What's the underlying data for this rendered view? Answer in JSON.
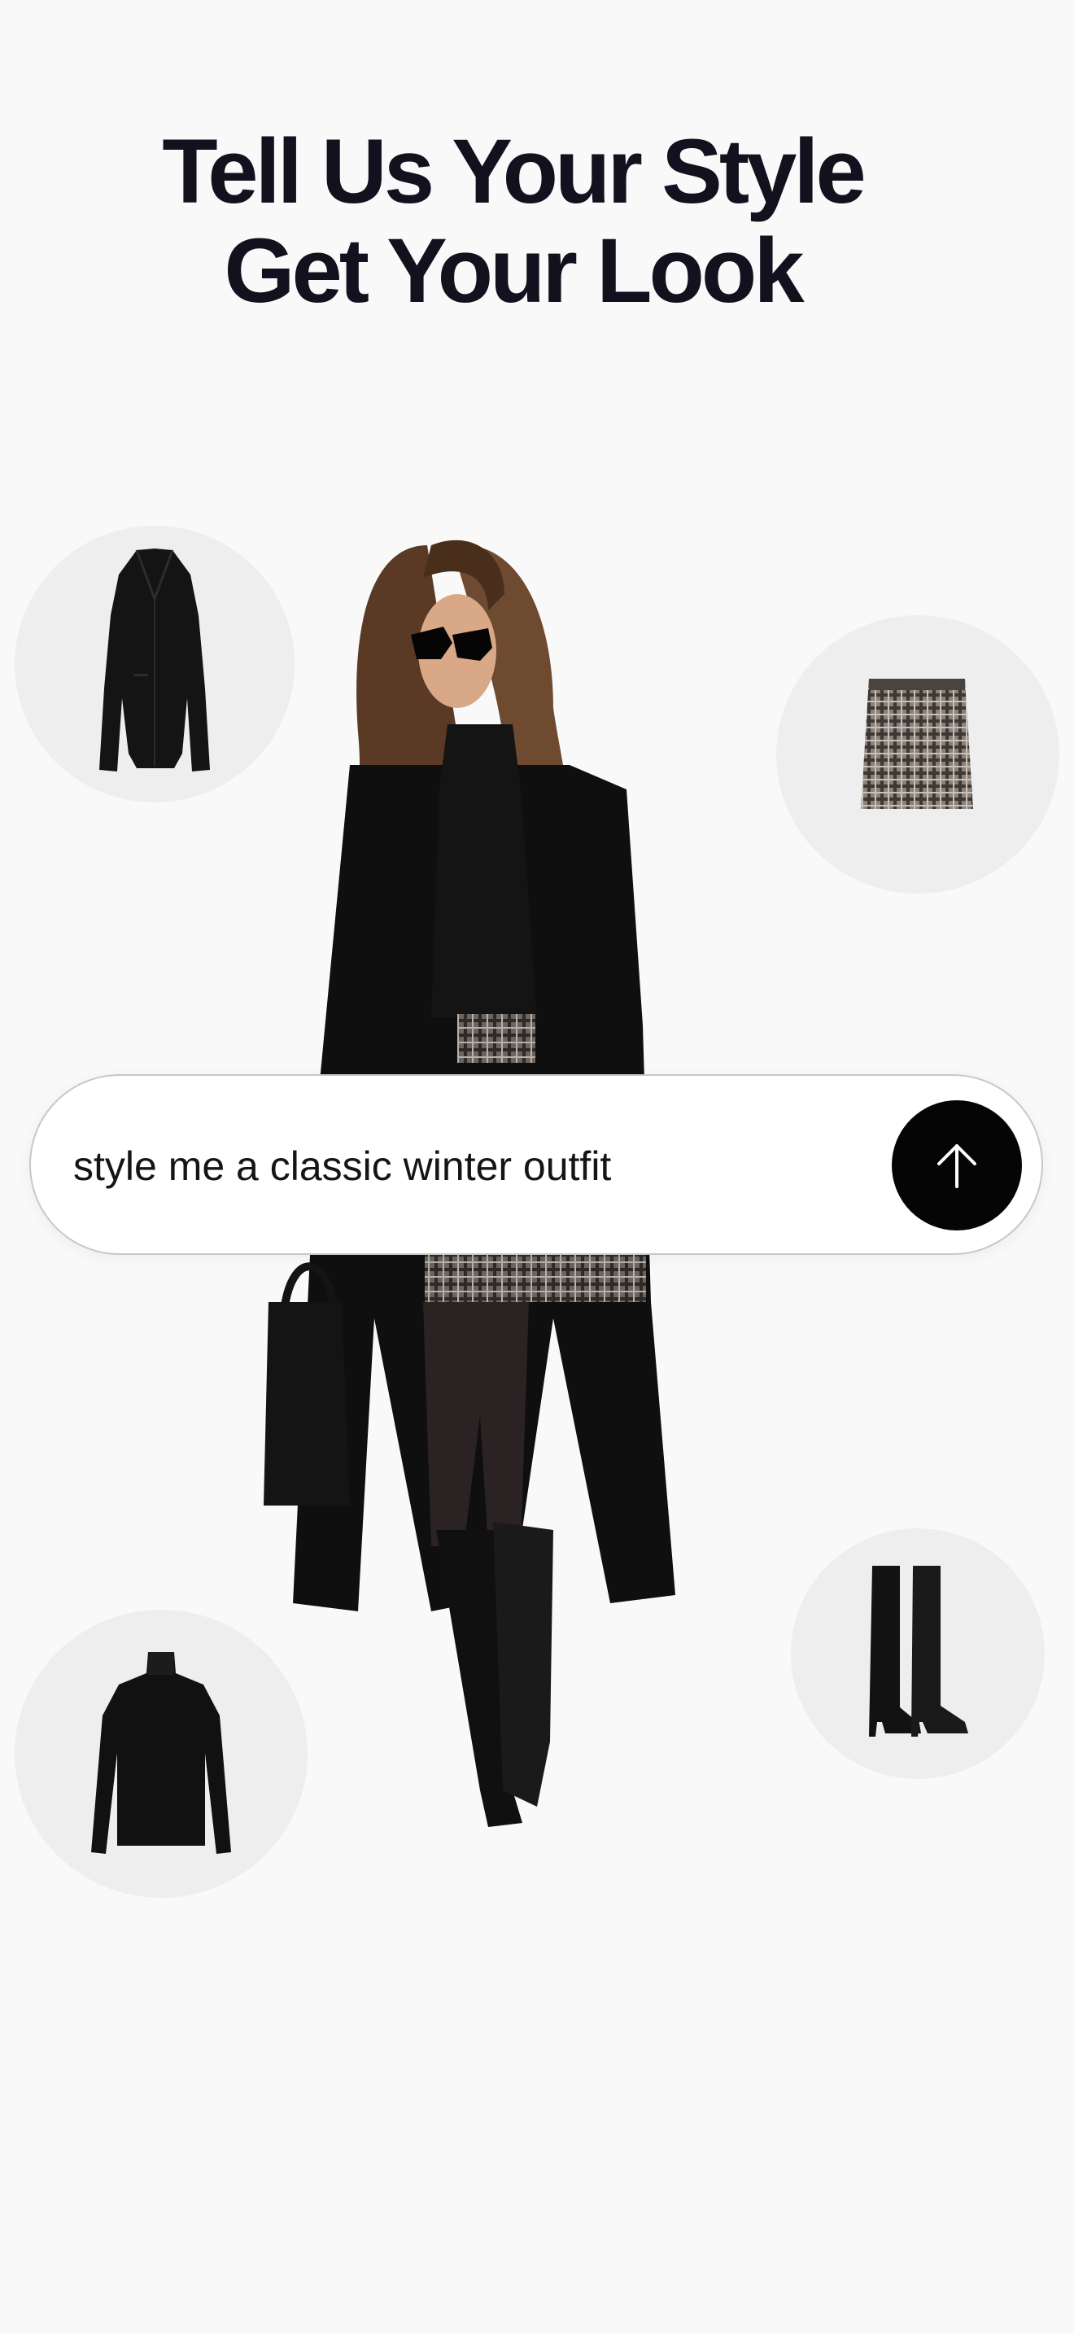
{
  "headline": {
    "line1": "Tell Us Your Style",
    "line2": "Get Your Look"
  },
  "prompt": {
    "value": "style me a classic winter outfit",
    "send_icon": "arrow-up-icon"
  },
  "items": [
    {
      "name": "coat",
      "icon": "black-long-coat"
    },
    {
      "name": "skirt",
      "icon": "plaid-mini-skirt"
    },
    {
      "name": "turtleneck",
      "icon": "black-turtleneck-top"
    },
    {
      "name": "boots",
      "icon": "black-knee-high-boots"
    }
  ],
  "model": {
    "icon": "model-wearing-winter-outfit"
  },
  "colors": {
    "background": "#f9f9f9",
    "headline": "#14111f",
    "circle": "#eeeeee",
    "send_button": "#050505",
    "plaid": "#6b6460"
  }
}
